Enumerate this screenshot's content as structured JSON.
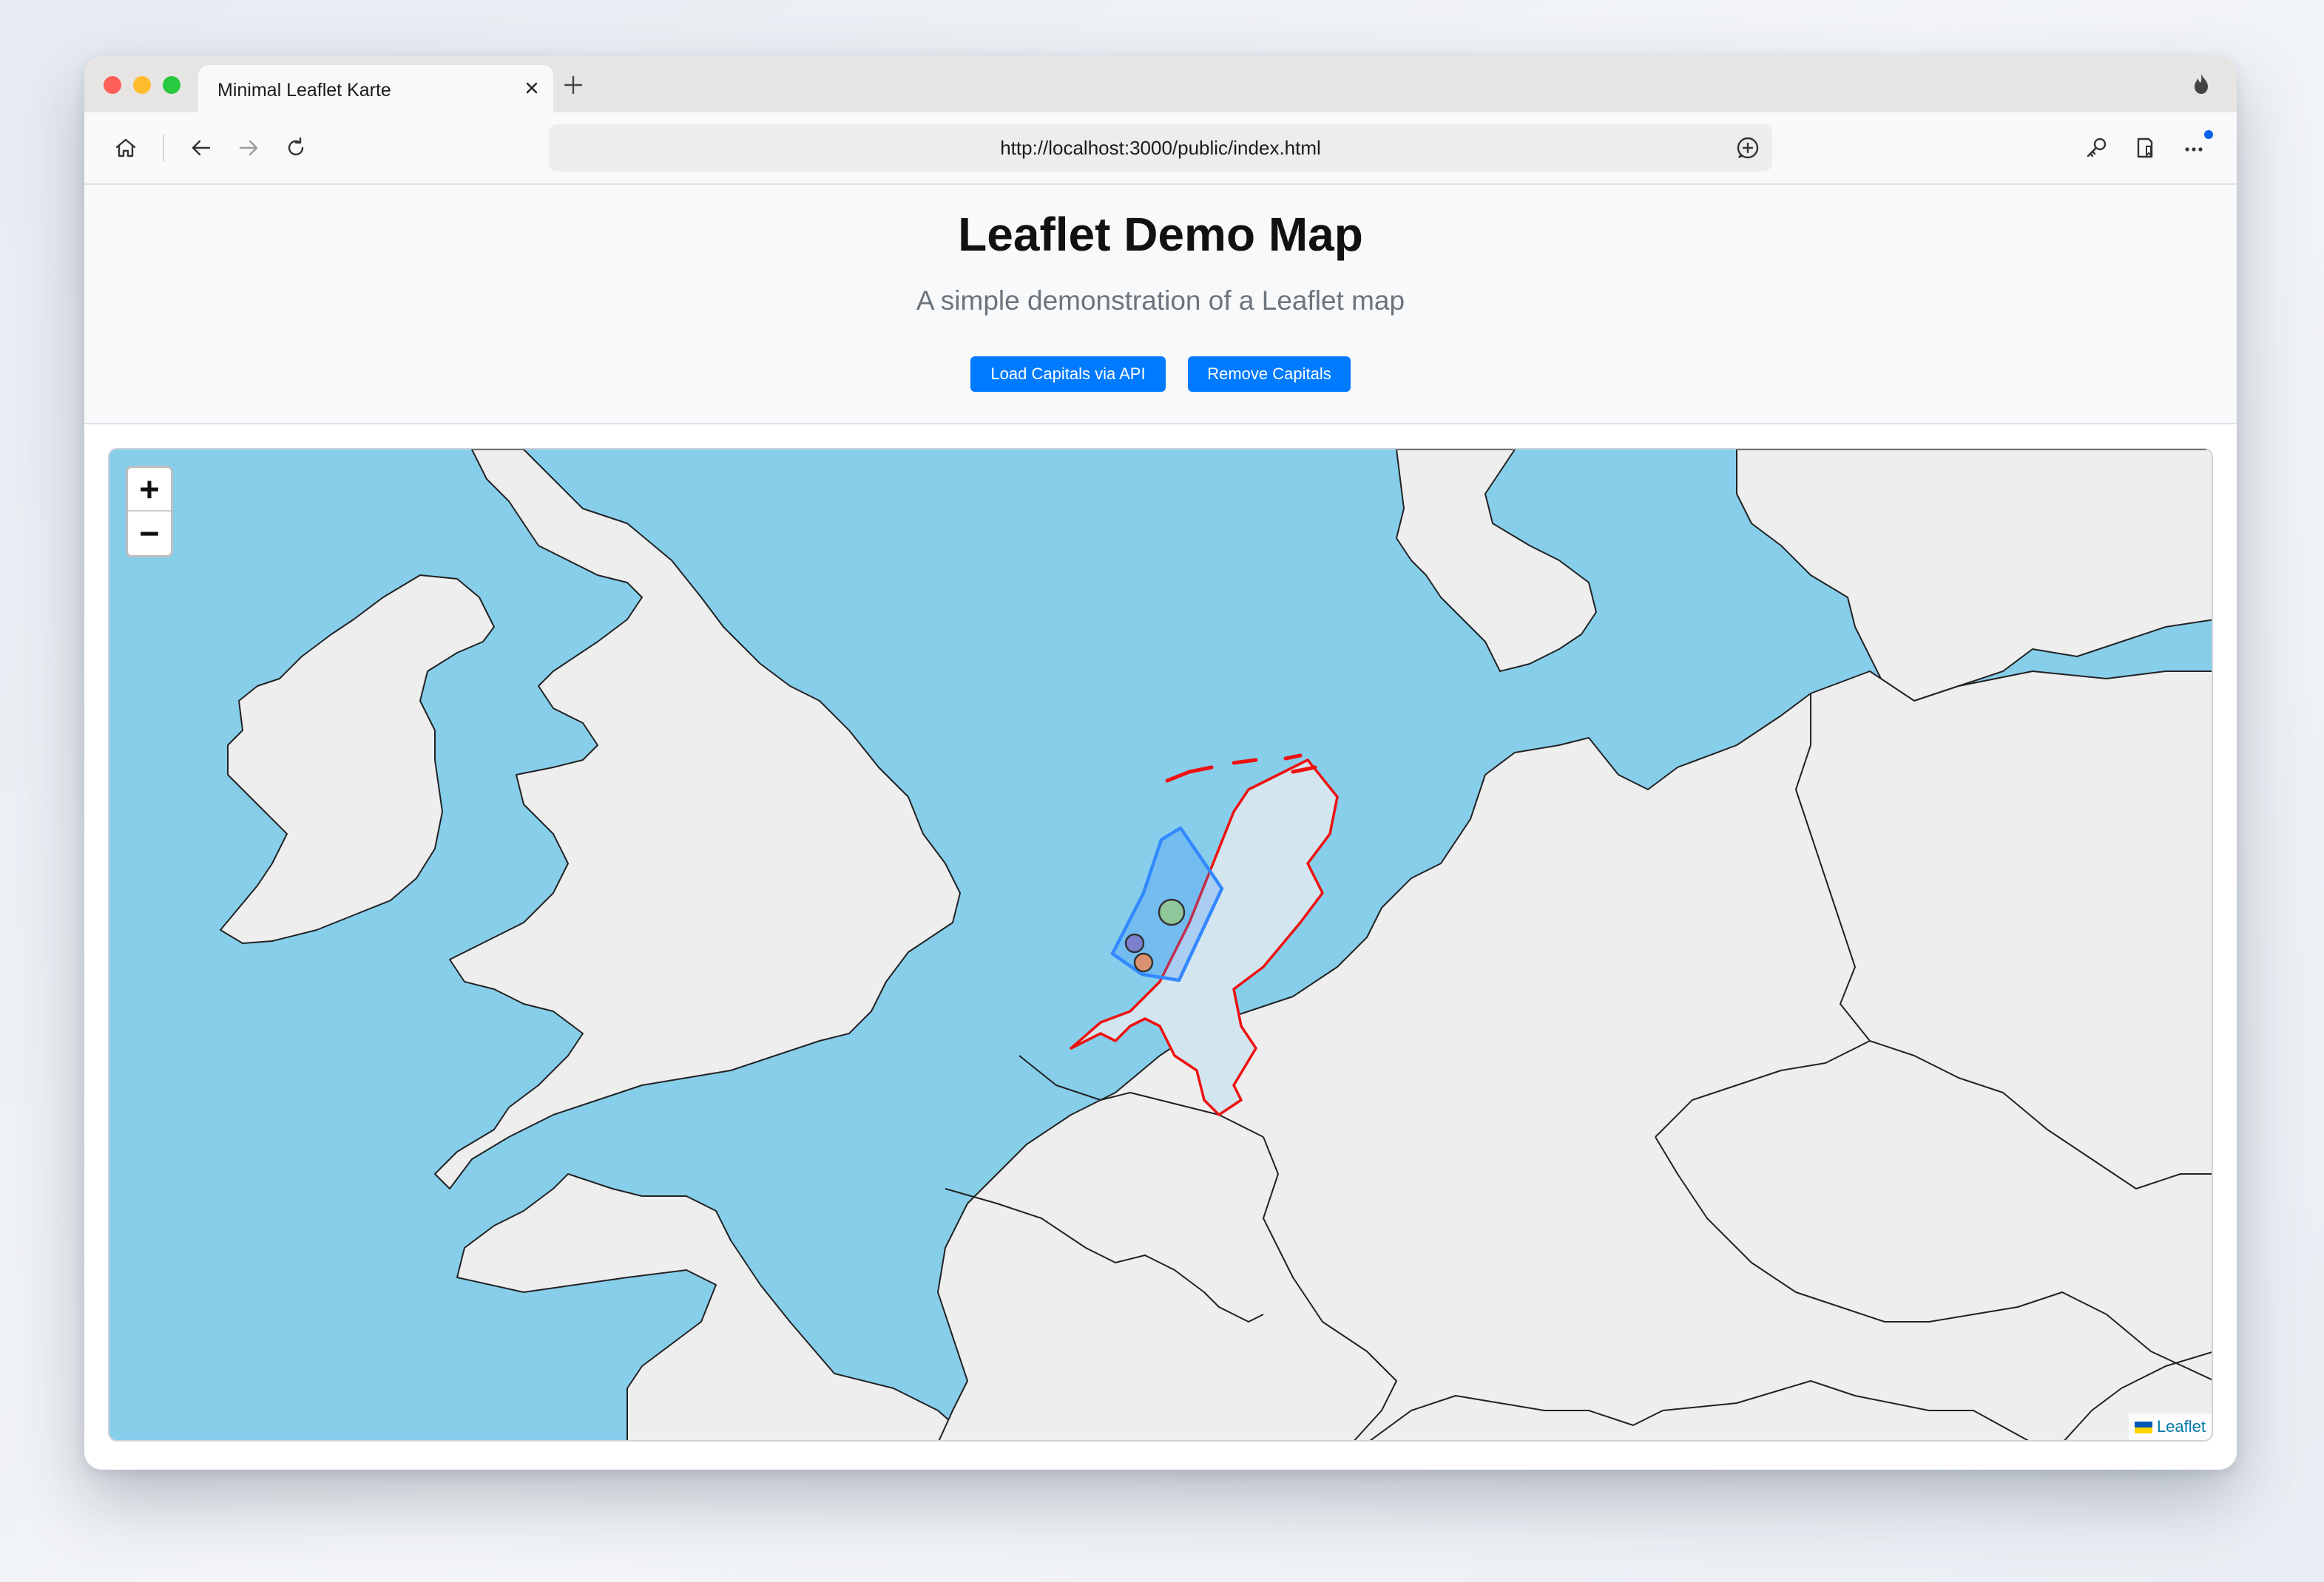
{
  "browser": {
    "tab_title": "Minimal Leaflet Karte",
    "url": "http://localhost:3000/public/index.html",
    "icons": [
      "home-icon",
      "back-icon",
      "forward-icon",
      "reload-icon",
      "key-icon",
      "reader-icon",
      "more-icon",
      "fire-icon"
    ]
  },
  "header": {
    "title": "Leaflet Demo Map",
    "subtitle": "A simple demonstration of a Leaflet map",
    "buttons": {
      "load": "Load Capitals via API",
      "remove": "Remove Capitals"
    },
    "button_color": "#007bff"
  },
  "map": {
    "zoom_in": "+",
    "zoom_out": "−",
    "attribution": "Leaflet",
    "colors": {
      "water": "#87ceeb",
      "land": "#eeeeee",
      "border": "#222222",
      "netherlands_outline": "#ee1111",
      "netherlands_fill": "#d3e5ee",
      "polygon_stroke": "#3388ff",
      "marker_green": "#8fc79a",
      "marker_blue": "#7a80cc",
      "marker_orange": "#d99270"
    },
    "region_shown": "Western Europe (British Isles, Benelux, Germany, Denmark)"
  }
}
